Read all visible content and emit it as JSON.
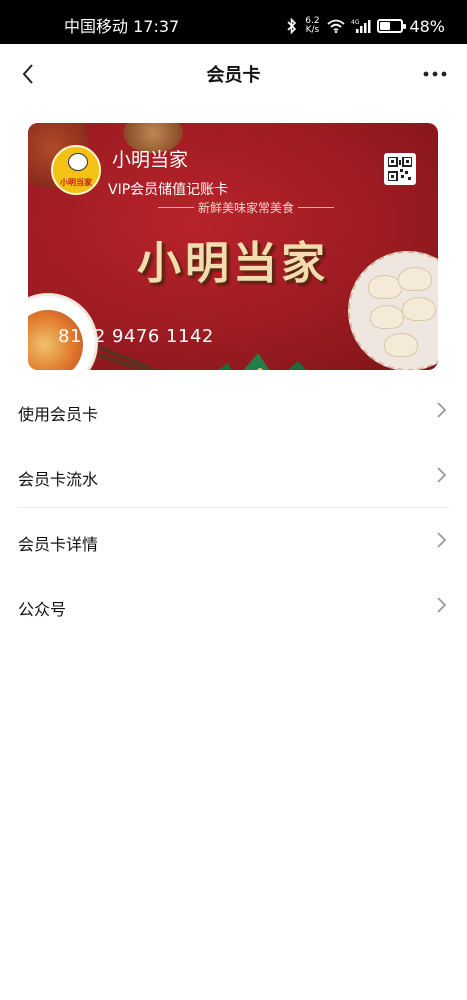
{
  "status_bar": {
    "carrier_time": "中国移动 17:37",
    "net_speed_value": "6.2",
    "net_speed_unit": "K/s",
    "signal_label": "4G",
    "battery_percent": "48%",
    "battery_level": 0.48
  },
  "nav": {
    "title": "会员卡",
    "back_icon": "chevron-left-icon",
    "more_icon": "more-dots-icon"
  },
  "card": {
    "logo_text": "小明当家",
    "brand_name": "小明当家",
    "subtitle": "VIP会员储值记账卡",
    "slogan": "新鲜美味家常美食",
    "big_name": "小明当家",
    "card_number": "8192 9476 1142",
    "qr_icon": "qr-code-icon",
    "colors": {
      "primary": "#9c1c22",
      "accent_gold": "#f3dcae",
      "logo_yellow": "#f4c215"
    }
  },
  "menu": {
    "items": [
      {
        "label": "使用会员卡"
      },
      {
        "label": "会员卡流水"
      },
      {
        "label": "会员卡详情"
      },
      {
        "label": "公众号"
      }
    ]
  }
}
